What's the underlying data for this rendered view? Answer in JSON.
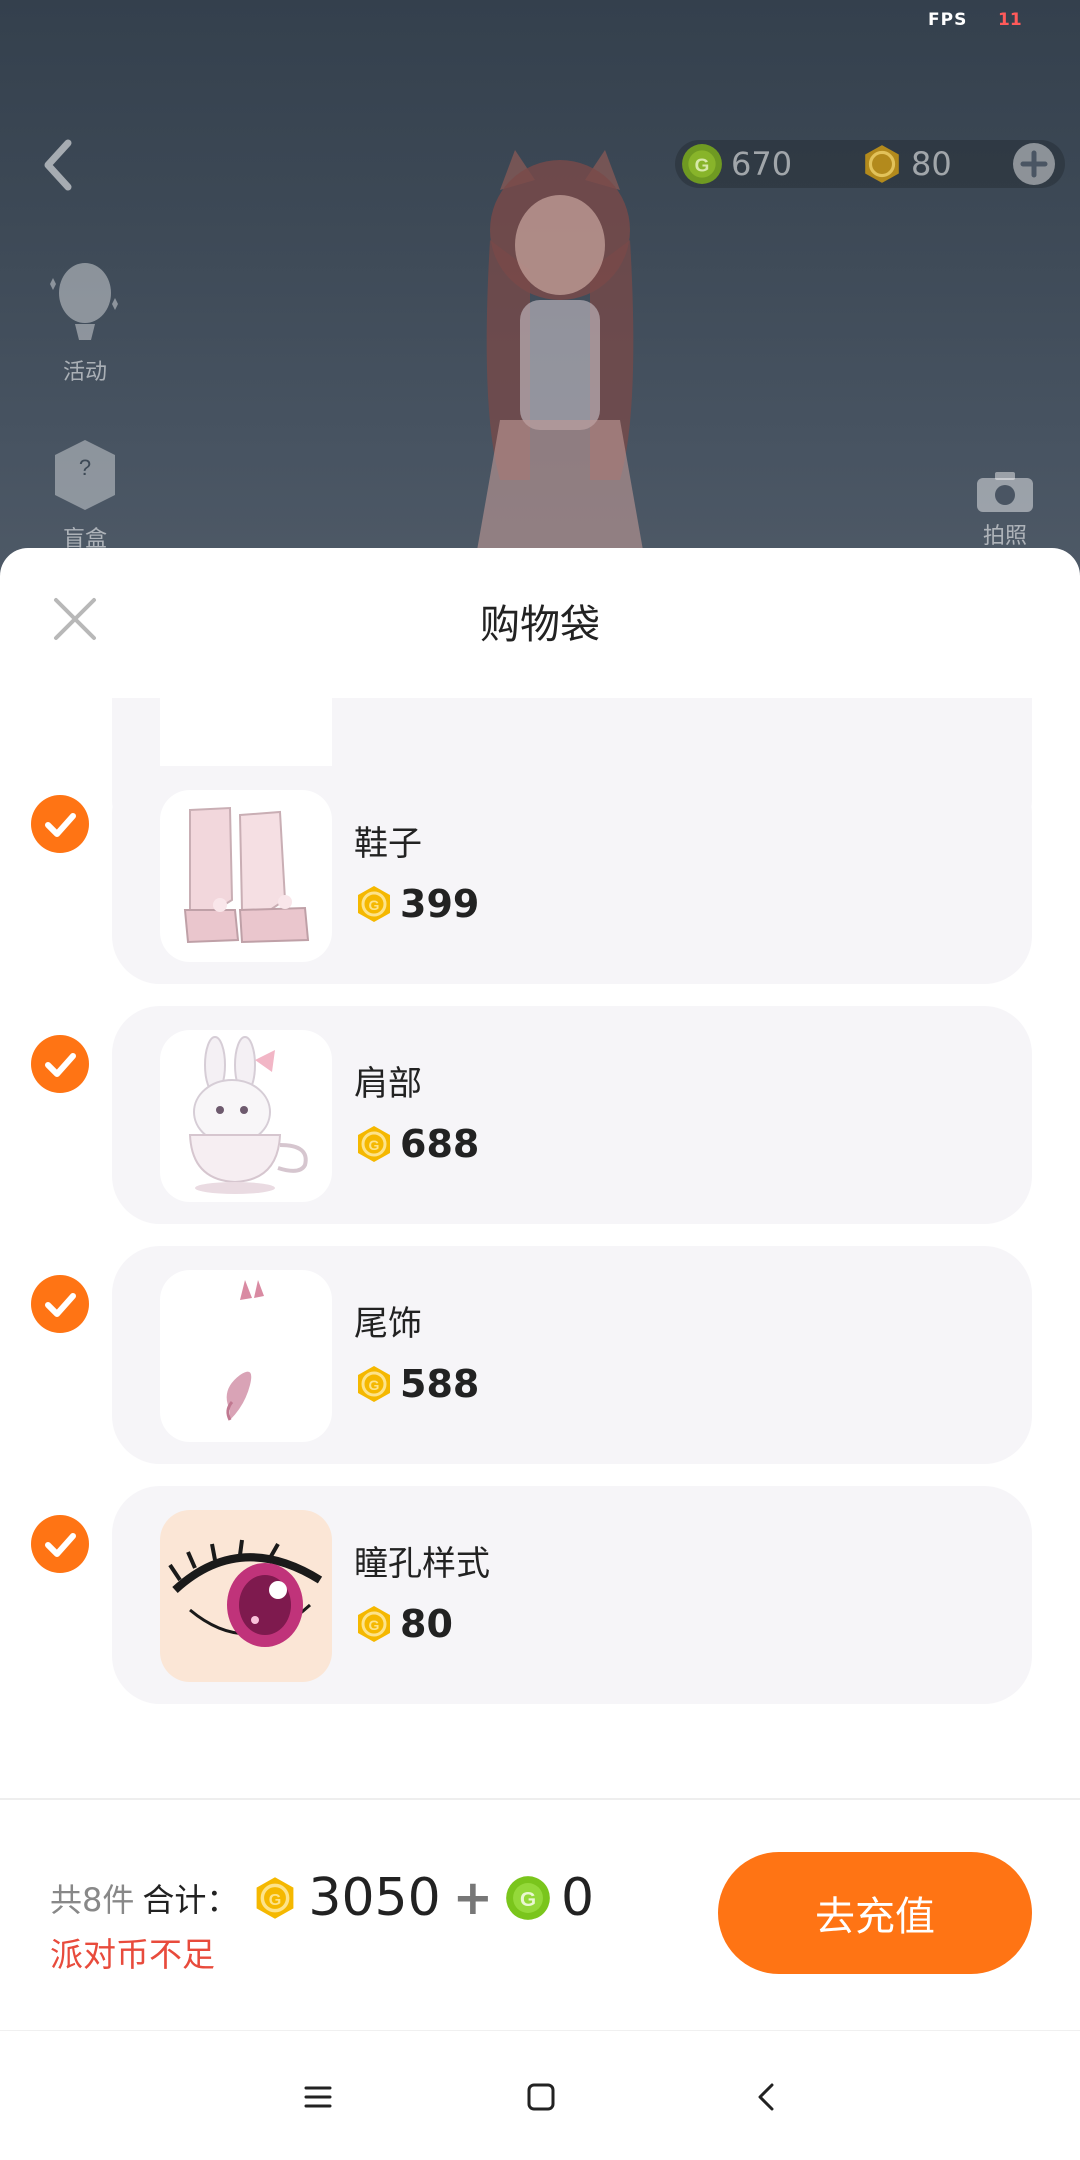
{
  "overlay": {
    "fps_label": "FPS",
    "fps_value": "11",
    "currency_green": "670",
    "currency_gold": "80",
    "side_buttons": [
      {
        "label": "活动",
        "icon": "balloon-icon"
      },
      {
        "label": "盲盒",
        "icon": "mystery-box-icon"
      }
    ],
    "photo_label": "拍照"
  },
  "sheet": {
    "title": "购物袋",
    "items": [
      {
        "name": "鞋子",
        "price": "399",
        "icon": "shoes-thumbnail"
      },
      {
        "name": "肩部",
        "price": "688",
        "icon": "bunny-teacup-thumbnail"
      },
      {
        "name": "尾饰",
        "price": "588",
        "icon": "tail-thumbnail"
      },
      {
        "name": "瞳孔样式",
        "price": "80",
        "icon": "eye-pupil-thumbnail"
      }
    ]
  },
  "footer": {
    "count": "共8件",
    "total_label": "合计：",
    "gold_total": "3050",
    "plus": "+",
    "green_total": "0",
    "warning": "派对币不足",
    "button": "去充值"
  },
  "colors": {
    "accent": "#ff7414",
    "gold_coin": "#f5b800",
    "green_coin": "#7ac51c",
    "warning": "#e84b3c"
  }
}
